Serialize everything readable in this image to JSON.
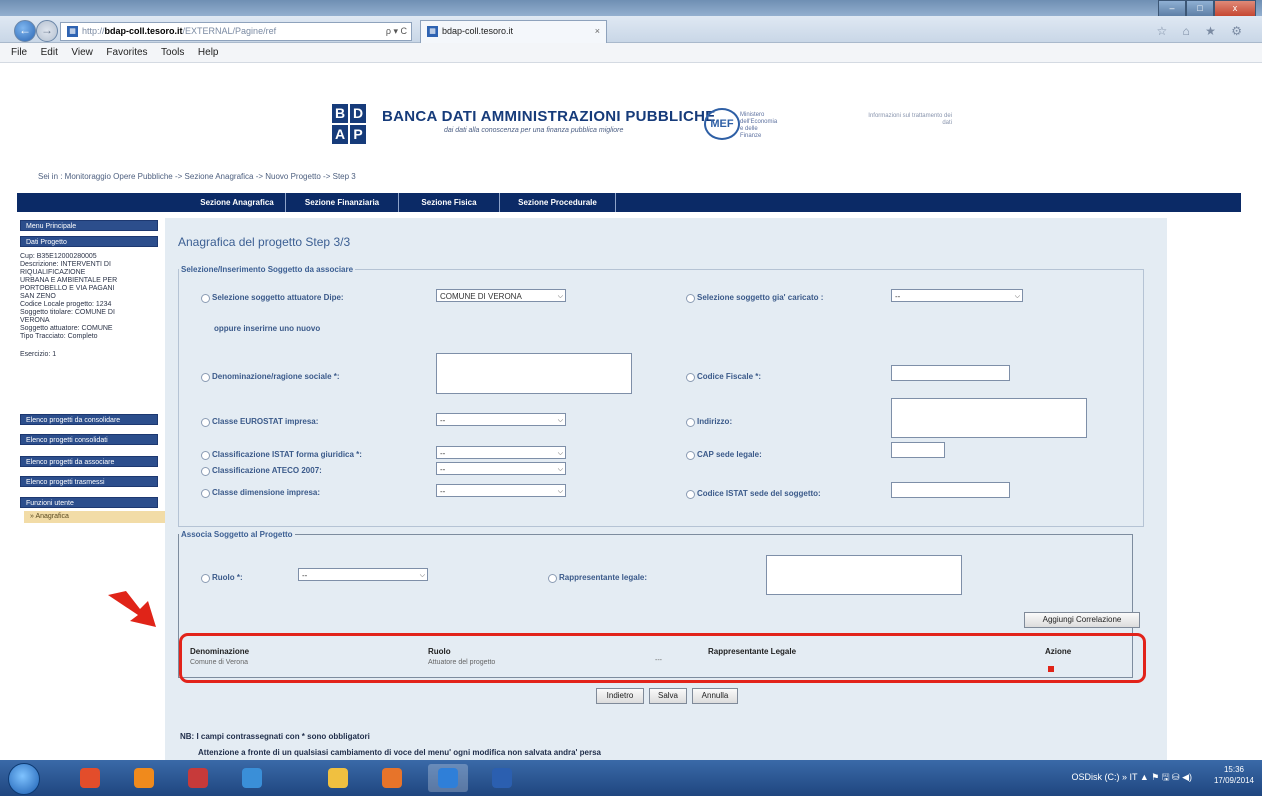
{
  "browser": {
    "url_prefix": "http://",
    "url_host": "bdap-coll.tesoro.it",
    "url_tail": "/EXTERNAL/Pagine/ref",
    "tab_title": "bdap-coll.tesoro.it",
    "tab_close": "×",
    "back_symbol": "←",
    "forward_symbol": "→",
    "search_symbol": "ρ ▾ C",
    "right_icons": "☆ ⌂ ★ ⚙",
    "window_controls": [
      "–",
      "□",
      "x"
    ]
  },
  "menu": [
    "File",
    "Edit",
    "View",
    "Favorites",
    "Tools",
    "Help"
  ],
  "header": {
    "logo_letters": [
      "B",
      "D",
      "A",
      "P"
    ],
    "title": "BANCA DATI AMMINISTRAZIONI PUBBLICHE",
    "subtitle": "dai dati alla conoscenza per una finanza pubblica migliore",
    "mef": "MEF",
    "mef_text": "Ministero dell'Economia e delle Finanze",
    "topright": "Informazioni sul trattamento dei dati"
  },
  "breadcrumb": "Sei in : Monitoraggio Opere Pubbliche -> Sezione Anagrafica -> Nuovo Progetto -> Step 3",
  "nav": [
    "Sezione Anagrafica",
    "Sezione Finanziaria",
    "Sezione Fisica",
    "Sezione Procedurale"
  ],
  "sidebar": {
    "buttons": [
      "Menu Principale",
      "Dati Progetto"
    ],
    "info": [
      "Cup: B35E12000280005",
      "Descrizione: INTERVENTI DI",
      "RIQUALIFICAZIONE",
      "URBANA E AMBIENTALE PER",
      "PORTOBELLO E VIA PAGANI",
      "SAN ZENO",
      "Codice Locale progetto: 1234",
      "Soggetto titolare: COMUNE DI",
      "VERONA",
      "Soggetto attuatore: COMUNE",
      "Tipo Tracciato: Completo",
      "Esercizio: 1"
    ],
    "links": [
      "Elenco progetti da consolidare",
      "Elenco progetti consolidati",
      "Elenco progetti da associare",
      "Elenco progetti trasmessi",
      "Funzioni utente"
    ],
    "active": "» Anagrafica"
  },
  "page": {
    "title": "Anagrafica del progetto Step 3/3",
    "fieldset1_legend": "Selezione/Inserimento Soggetto da associare",
    "fieldset2_legend": "Associa Soggetto al Progetto",
    "labels": {
      "sel_attuatore": "Selezione soggetto attuatore Dipe:",
      "sel_caricato": "Selezione soggetto gia' caricato :",
      "oppure": "oppure inserirne uno nuovo",
      "denominazione": "Denominazione/ragione sociale *:",
      "codice_fiscale": "Codice Fiscale *:",
      "eurostat": "Classe EUROSTAT impresa:",
      "indirizzo": "Indirizzo:",
      "istat_giuridica": "Classificazione ISTAT forma giuridica *:",
      "cap": "CAP sede legale:",
      "ateco": "Classificazione ATECO 2007:",
      "dimensione": "Classe dimensione impresa:",
      "istat_sede": "Codice ISTAT sede del soggetto:",
      "ruolo": "Ruolo *:",
      "rappresentante": "Rappresentante legale:"
    },
    "select_values": {
      "attuatore": "COMUNE DI VERONA",
      "caricato": "--",
      "eurostat": "--",
      "istat_giuridica": "--",
      "ateco": "--",
      "dimensione": "--",
      "ruolo": "--"
    },
    "buttons": {
      "aggiungi": "Aggiungi Correlazione",
      "indietro": "Indietro",
      "salva": "Salva",
      "annulla": "Annulla"
    },
    "table": {
      "headers": [
        "Denominazione",
        "Ruolo",
        "Rappresentante Legale",
        "Azione"
      ],
      "row": [
        "Comune di Verona",
        "Attuatore del progetto",
        "---"
      ]
    },
    "note1": "NB: I campi contrassegnati con * sono obbligatori",
    "note2": "Attenzione a fronte di un qualsiasi cambiamento di voce del menu' ogni modifica non salvata andra' persa"
  },
  "taskbar": {
    "tray": "OSDisk (C:)   »   IT   ▲  ⚑  🖫  ⛁  ◀)",
    "time": "15:36",
    "date": "17/09/2014",
    "app_colors": [
      "#e34d2b",
      "#f08a1c",
      "#c73a3a",
      "#3a8fd8",
      "#f0c040",
      "#e7742a",
      "#2f7fd8",
      "#2b5fb0"
    ]
  }
}
